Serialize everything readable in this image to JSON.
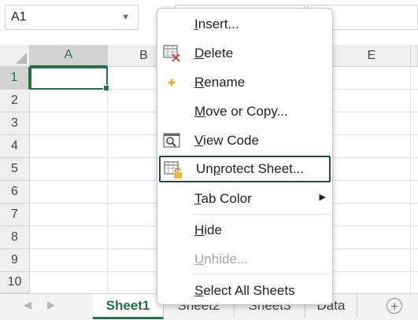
{
  "name_box": {
    "value": "A1"
  },
  "columns": [
    {
      "label": "A",
      "selected": true
    },
    {
      "label": "B",
      "selected": false
    },
    {
      "label": "E",
      "selected": false
    }
  ],
  "rows": [
    "1",
    "2",
    "3",
    "4",
    "5",
    "6",
    "7",
    "8",
    "9",
    "10"
  ],
  "context_menu": {
    "items": [
      {
        "pre": "",
        "key": "I",
        "post": "nsert...",
        "icon": "",
        "disabled": false
      },
      {
        "pre": "",
        "key": "D",
        "post": "elete",
        "icon": "delete-sheet-icon",
        "disabled": false
      },
      {
        "pre": "",
        "key": "R",
        "post": "ename",
        "icon": "rename-icon",
        "disabled": false
      },
      {
        "pre": "",
        "key": "M",
        "post": "ove or Copy...",
        "icon": "",
        "disabled": false
      },
      {
        "pre": "",
        "key": "V",
        "post": "iew Code",
        "icon": "view-code-icon",
        "disabled": false
      },
      {
        "pre": "Un",
        "key": "p",
        "post": "rotect Sheet...",
        "icon": "unprotect-sheet-icon",
        "disabled": false
      },
      {
        "pre": "",
        "key": "T",
        "post": "ab Color",
        "icon": "",
        "disabled": false,
        "submenu": true
      },
      {
        "pre": "",
        "key": "H",
        "post": "ide",
        "icon": "",
        "disabled": false
      },
      {
        "pre": "",
        "key": "U",
        "post": "nhide...",
        "icon": "",
        "disabled": true
      },
      {
        "pre": "",
        "key": "S",
        "post": "elect All Sheets",
        "icon": "",
        "disabled": false
      }
    ]
  },
  "sheet_tabs": [
    {
      "label": "Sheet1",
      "active": true
    },
    {
      "label": "Sheet2",
      "active": false
    },
    {
      "label": "Sheet3",
      "active": false
    },
    {
      "label": "Data",
      "active": false
    }
  ],
  "add_sheet_symbol": "+",
  "colors": {
    "accent": "#217346",
    "highlight_border": "#1e4d45",
    "rename_icon": "#f5a623",
    "delete_x": "#d9432b"
  }
}
